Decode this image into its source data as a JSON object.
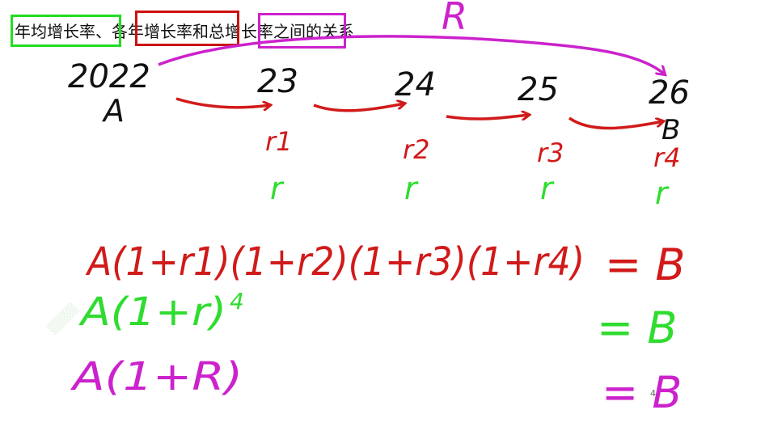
{
  "title": {
    "part1": "年均增长率",
    "sep": "、",
    "part2": "各年增长率",
    "part3": "和",
    "part4": "总增长率",
    "part5": "之间的关系"
  },
  "annotation": {
    "total_rate_symbol": "R"
  },
  "timeline": {
    "years": [
      "2022",
      "23",
      "24",
      "25",
      "26"
    ],
    "start_label": "A",
    "end_label": "B",
    "yearly_rates": [
      "r1",
      "r2",
      "r3",
      "r4"
    ],
    "average_rate": "r"
  },
  "equations": {
    "yearly": "A(1+r1)(1+r2)(1+r3)(1+r4)",
    "yearly_rhs": "= B",
    "average": "A(1+r)",
    "average_exponent": "4",
    "average_rhs": "= B",
    "total": "A(1+R)",
    "total_rhs": "= B",
    "total_rhs_mark": "4"
  },
  "colors": {
    "ink": "#111111",
    "red": "#d11a1a",
    "green": "#2fdc2f",
    "purple": "#cc22cc",
    "background": "#ffffff"
  }
}
